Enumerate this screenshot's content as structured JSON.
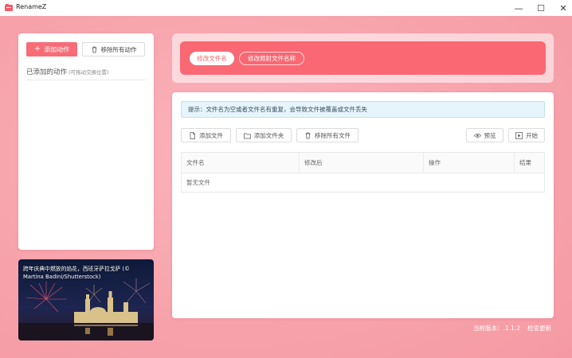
{
  "app": {
    "title": "RenameZ"
  },
  "window": {
    "minimize": "—",
    "maximize": "☐",
    "close": "✕"
  },
  "left": {
    "add_action": "添加动作",
    "remove_all_actions": "移除所有动作",
    "added_title": "已添加的动作",
    "drag_hint": "(可拖动交换位置)"
  },
  "wallpaper": {
    "caption": "跨年庆典中燃放的焰花，西班牙萨拉戈萨 (© Martina Badini/Shutterstock)"
  },
  "tabs": [
    {
      "label": "修改文件名"
    },
    {
      "label": "修改照射文件名称"
    }
  ],
  "main": {
    "tip": "提示：文件名为空或者文件名有重复，会导致文件被覆盖或文件丢失",
    "toolbar": {
      "add_file": "添加文件",
      "add_folder": "添加文件夹",
      "remove_all_files": "移除所有文件",
      "preview": "预览",
      "start": "开始"
    },
    "table": {
      "columns": [
        "文件名",
        "修改后",
        "操作",
        "结果"
      ],
      "empty": "暂无文件"
    }
  },
  "footer": {
    "version": "当前版本：.1.1.2",
    "check_update": "检查更新"
  },
  "colors": {
    "accent": "#f76c77",
    "background": "#f7a4ad",
    "tip_bg": "#e6f4fc"
  }
}
